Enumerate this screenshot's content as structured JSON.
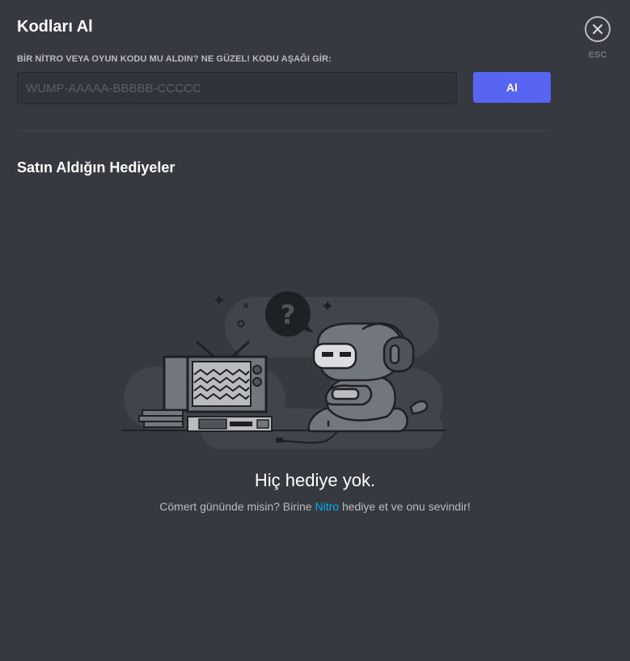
{
  "header": {
    "title": "Kodları Al"
  },
  "redeem": {
    "label": "BİR NİTRO VEYA OYUN KODU MU ALDIN? NE GÜZEL! KODU AŞAĞI GİR:",
    "placeholder": "WUMP-AAAAA-BBBBB-CCCCC",
    "value": "",
    "button_label": "Al"
  },
  "close": {
    "icon": "close-icon",
    "esc_label": "ESC"
  },
  "gifts": {
    "section_title": "Satın Aldığın Hediyeler",
    "empty_title": "Hiç hediye yok.",
    "empty_text_before": "Cömert gününde misin? Birine ",
    "empty_link": "Nitro",
    "empty_text_after": " hediye et ve onu sevindir!"
  },
  "colors": {
    "background": "#36393f",
    "accent": "#5865f2",
    "link": "#00b0f4"
  }
}
